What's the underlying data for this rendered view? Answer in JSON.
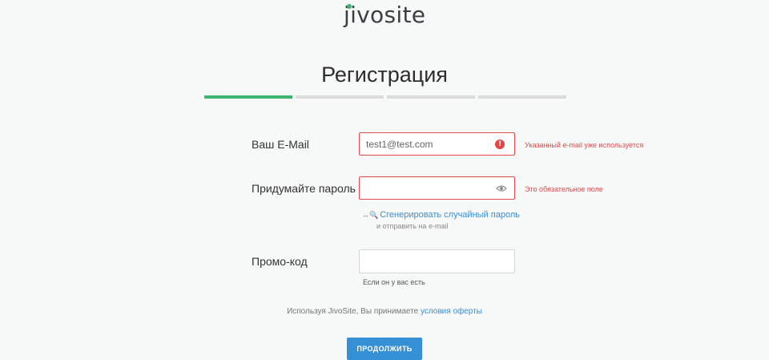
{
  "logo": {
    "first": "j",
    "rest": "ivosite",
    "dot_color": "#3cb46e"
  },
  "page": {
    "title": "Регистрация"
  },
  "progress": {
    "total_steps": 4,
    "current_step": 1,
    "active_color": "#3eb56e"
  },
  "email": {
    "label": "Ваш E-Mail",
    "value": "test1@test.com",
    "icon": "error-icon",
    "icon_glyph": "!",
    "error": "Указанный e-mail уже используется"
  },
  "password": {
    "label": "Придумайте пароль",
    "value": "",
    "icon": "eye-icon",
    "error": "Это обязательное поле",
    "generate_icon": "↔🔍",
    "generate_link": "Сгенерировать случайный пароль",
    "generate_sub": "и отправить на e-mail"
  },
  "promo": {
    "label": "Промо-код",
    "value": "",
    "hint": "Если он у вас есть"
  },
  "terms": {
    "text": "Используя JivoSite, Вы принимаете ",
    "link": "условия оферты"
  },
  "submit": {
    "label": "ПРОДОЛЖИТЬ"
  },
  "colors": {
    "error": "#e14b4b",
    "link": "#3b8fd5",
    "button": "#3590d6"
  }
}
